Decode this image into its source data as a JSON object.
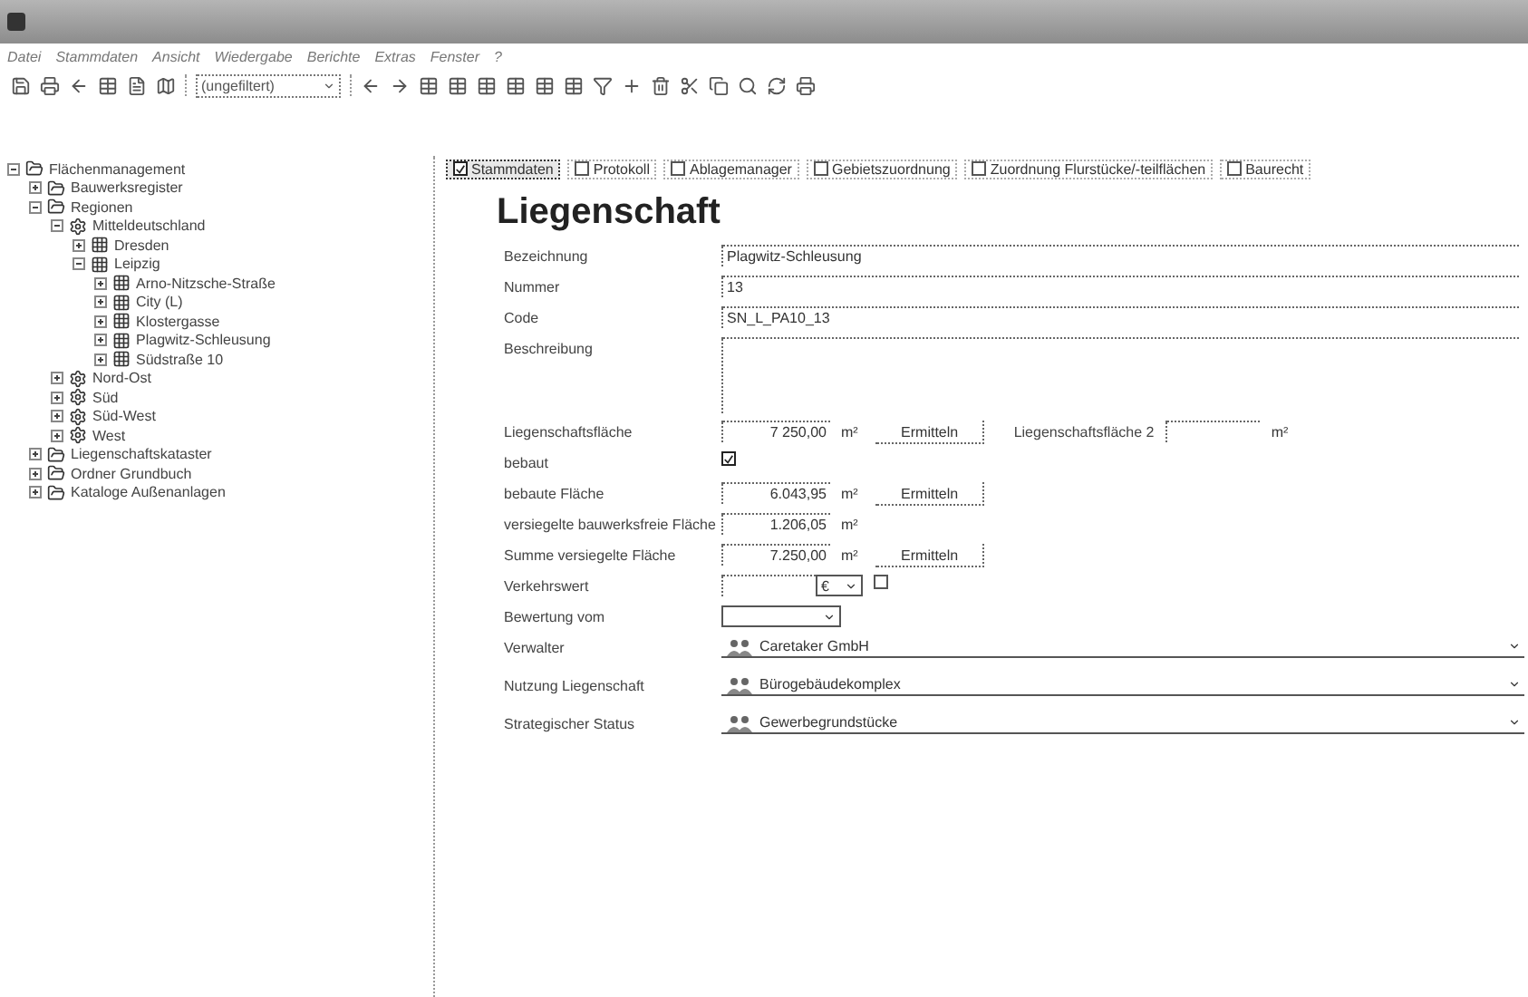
{
  "menu": [
    "Datei",
    "Stammdaten",
    "Ansicht",
    "Wiedergabe",
    "Berichte",
    "Extras",
    "Fenster",
    "?"
  ],
  "toolbar": {
    "filter": "(ungefiltert)"
  },
  "tree": [
    {
      "label": "Flächenmanagement",
      "kind": "root",
      "expanded": true,
      "children": [
        {
          "label": "Bauwerksregister",
          "kind": "folder",
          "expanded": false
        },
        {
          "label": "Regionen",
          "kind": "folder",
          "expanded": true,
          "children": [
            {
              "label": "Mitteldeutschland",
              "kind": "region",
              "expanded": true,
              "children": [
                {
                  "label": "Dresden",
                  "kind": "city",
                  "expanded": false
                },
                {
                  "label": "Leipzig",
                  "kind": "city",
                  "expanded": true,
                  "children": [
                    {
                      "label": "Arno-Nitzsche-Straße",
                      "kind": "property",
                      "expanded": false
                    },
                    {
                      "label": "City (L)",
                      "kind": "property",
                      "expanded": false
                    },
                    {
                      "label": "Klostergasse",
                      "kind": "property",
                      "expanded": false
                    },
                    {
                      "label": "Plagwitz-Schleusung",
                      "kind": "property",
                      "expanded": false
                    },
                    {
                      "label": "Südstraße 10",
                      "kind": "property",
                      "expanded": false
                    }
                  ]
                }
              ]
            },
            {
              "label": "Nord-Ost",
              "kind": "region",
              "expanded": false
            },
            {
              "label": "Süd",
              "kind": "region",
              "expanded": false
            },
            {
              "label": "Süd-West",
              "kind": "region",
              "expanded": false
            },
            {
              "label": "West",
              "kind": "region",
              "expanded": false
            }
          ]
        },
        {
          "label": "Liegenschaftskataster",
          "kind": "folder",
          "expanded": false
        },
        {
          "label": "Ordner Grundbuch",
          "kind": "folder",
          "expanded": false
        },
        {
          "label": "Kataloge Außenanlagen",
          "kind": "folder",
          "expanded": false
        }
      ]
    }
  ],
  "tabs": [
    {
      "label": "Stammdaten",
      "selected": true,
      "checked": true
    },
    {
      "label": "Protokoll",
      "selected": false,
      "checked": false
    },
    {
      "label": "Ablagemanager",
      "selected": false,
      "checked": false
    },
    {
      "label": "Gebietszuordnung",
      "selected": false,
      "checked": false
    },
    {
      "label": "Zuordnung Flurstücke/-teilflächen",
      "selected": false,
      "checked": false
    },
    {
      "label": "Baurecht",
      "selected": false,
      "checked": false
    }
  ],
  "heading": "Liegenschaft",
  "fields": [
    {
      "kind": "text",
      "label": "Bezeichnung",
      "value": "Plagwitz-Schleusung"
    },
    {
      "kind": "text",
      "label": "Nummer",
      "value": "13"
    },
    {
      "kind": "text",
      "label": "Code",
      "value": "SN_L_PA10_13"
    },
    {
      "kind": "textarea",
      "label": "Beschreibung"
    },
    {
      "kind": "area",
      "label": "Liegenschaftsfläche",
      "value": "7 250,00",
      "unit": "m²",
      "button": "Ermitteln",
      "extra_label": "Liegenschaftsfläche 2",
      "extra_unit": "m²"
    },
    {
      "kind": "checkbox",
      "label": "bebaut",
      "checked": true
    },
    {
      "kind": "area",
      "label": "bebaute Fläche",
      "value": "6.043,95",
      "unit": "m²",
      "button": "Ermitteln"
    },
    {
      "kind": "area",
      "label": "versiegelte bauwerksfreie Fläche",
      "value": "1.206,05",
      "unit": "m²"
    },
    {
      "kind": "area",
      "label": "Summe versiegelte Fläche",
      "value": "7.250,00",
      "unit": "m²",
      "button": "Ermitteln"
    },
    {
      "kind": "currency",
      "label": "Verkehrswert",
      "unit": "€",
      "checked": false
    },
    {
      "kind": "date",
      "label": "Bewertung vom"
    },
    {
      "kind": "lookup",
      "label": "Verwalter",
      "value": "Caretaker GmbH"
    },
    {
      "kind": "lookup",
      "label": "Nutzung Liegenschaft",
      "value": "Bürogebäudekomplex"
    },
    {
      "kind": "lookup",
      "label": "Strategischer Status",
      "value": "Gewerbegrundstücke"
    }
  ]
}
